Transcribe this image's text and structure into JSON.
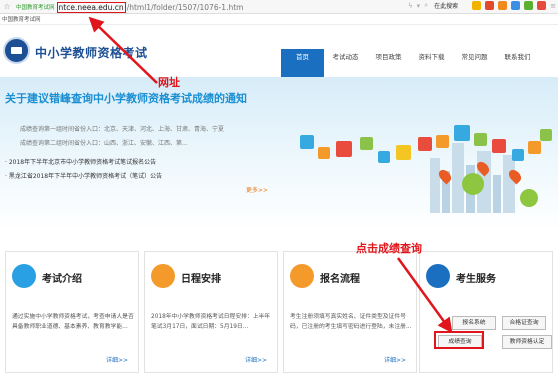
{
  "browser": {
    "site_badge": "中国教育考试网",
    "domain": "ntce.neea.edu.cn",
    "path": "/html1/folder/1507/1076-1.htm",
    "search_label": "在此搜索"
  },
  "bookmarks": {
    "item": "中国教育考试网"
  },
  "header": {
    "site_title": "中小学教师资格考试",
    "nav": [
      "首页",
      "考试动态",
      "项目政策",
      "资料下载",
      "常见问题",
      "联系我们"
    ]
  },
  "banner": {
    "title": "关于建议错峰查询中小学教师资格考试成绩的通知",
    "line1": "成绩查询第一组时间省份入口：北京、天津、河北、上海、甘肃、青海、宁夏",
    "line2": "成绩查询第二组时间省份入口：山西、浙江、安徽、江西、第...",
    "news": [
      "2018年下半年北京市中小学教师资格考试笔试报名公告",
      "黑龙江省2018年下半年中小学教师资格考试（笔试）公告"
    ],
    "more": "更多>>"
  },
  "cards": [
    {
      "title": "考试介绍",
      "text": "通过实施中小学教师资格考试，考查申请人是否具备教师职业道德、基本素养、教育教学能...",
      "more": "详细>>"
    },
    {
      "title": "日程安排",
      "text": "2018年中小学教师资格考试日程安排：上半年笔试3月17日，面试日期：5月19日...",
      "more": "详细>>"
    },
    {
      "title": "报名流程",
      "text": "考生注册须填写真实姓名、证件类型及证件号码，已注册的考生填写密码进行登陆，未注册...",
      "more": "详细>>"
    },
    {
      "title": "考生服务",
      "buttons": [
        "报名系统",
        "合格证查询",
        "成绩查询",
        "教师资格认定"
      ]
    }
  ],
  "annotations": {
    "url_note": "网址",
    "score_note": "点击成绩查询"
  },
  "colors": {
    "accent": "#1b6fc0",
    "annotation": "#e0161c",
    "link_orange": "#e67816"
  }
}
